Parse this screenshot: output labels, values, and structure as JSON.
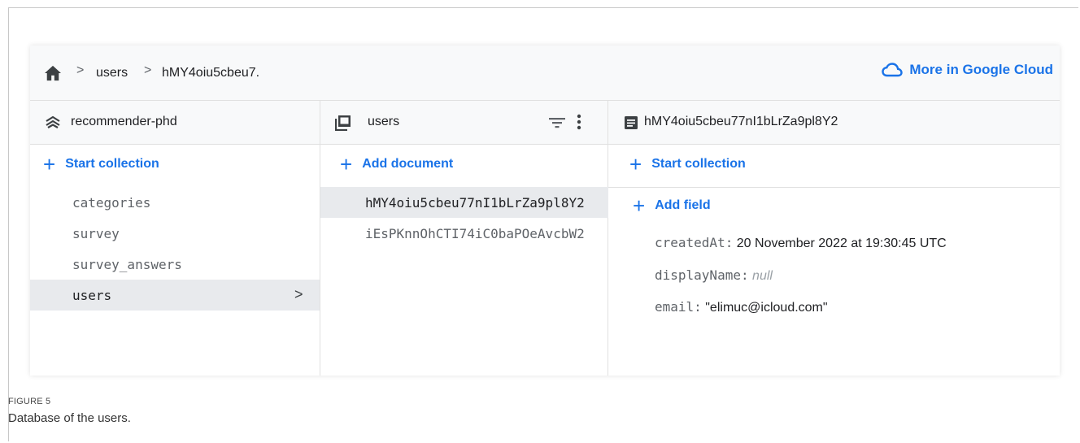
{
  "breadcrumb": {
    "home_icon": "home-icon",
    "items": [
      "users",
      "hMY4oiu5cbeu7."
    ],
    "separator": ">"
  },
  "header_action": {
    "icon": "cloud-icon",
    "label": "More in Google Cloud"
  },
  "columns": {
    "root": {
      "icon": "database-icon",
      "title": "recommender-phd",
      "action": "Start collection",
      "items": [
        "categories",
        "survey",
        "survey_answers",
        "users"
      ],
      "selected": "users"
    },
    "collection": {
      "icon": "collection-icon",
      "title": "users",
      "action": "Add document",
      "items": [
        "hMY4oiu5cbeu77nI1bLrZa9pl8Y2",
        "iEsPKnnOhCTI74iC0baPOeAvcbW2"
      ],
      "selected": "hMY4oiu5cbeu77nI1bLrZa9pl8Y2"
    },
    "document": {
      "icon": "document-icon",
      "title": "hMY4oiu5cbeu77nI1bLrZa9pl8Y2",
      "action_collection": "Start collection",
      "action_field": "Add field",
      "fields": [
        {
          "key": "createdAt:",
          "value": "20 November 2022 at 19:30:45 UTC"
        },
        {
          "key": "displayName:",
          "value": "null"
        },
        {
          "key": "email:",
          "value": "\"elimuc@icloud.com\""
        }
      ]
    }
  },
  "caption": {
    "label": "FIGURE 5",
    "text": "Database of the users."
  },
  "colors": {
    "accent": "#1a73e8",
    "selected_bg": "#e8eaed",
    "header_bg": "#f8f9fa"
  }
}
